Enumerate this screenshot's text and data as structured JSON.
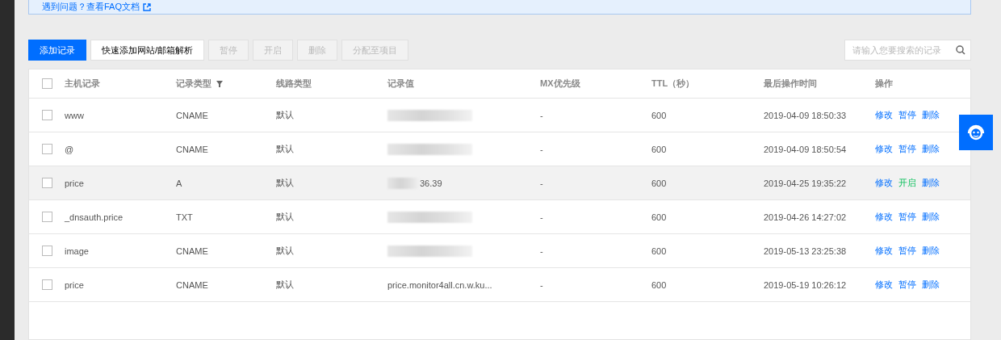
{
  "notice": {
    "text": "遇到问题？查看FAQ文档"
  },
  "toolbar": {
    "buttons": [
      {
        "label": "添加记录",
        "kind": "primary",
        "disabled": false
      },
      {
        "label": "快速添加网站/邮箱解析",
        "kind": "default",
        "disabled": false
      },
      {
        "label": "暂停",
        "kind": "default",
        "disabled": true
      },
      {
        "label": "开启",
        "kind": "default",
        "disabled": true
      },
      {
        "label": "删除",
        "kind": "default",
        "disabled": true
      },
      {
        "label": "分配至项目",
        "kind": "default",
        "disabled": true
      }
    ],
    "search": {
      "placeholder": "请输入您要搜索的记录"
    }
  },
  "table": {
    "columns": [
      {
        "label": "主机记录",
        "filter": false
      },
      {
        "label": "记录类型",
        "filter": true
      },
      {
        "label": "线路类型",
        "filter": false
      },
      {
        "label": "记录值",
        "filter": false
      },
      {
        "label": "MX优先级",
        "filter": false
      },
      {
        "label": "TTL（秒）",
        "filter": false
      },
      {
        "label": "最后操作时间",
        "filter": false
      },
      {
        "label": "操作",
        "filter": false
      }
    ],
    "header_checked": false,
    "rows": [
      {
        "checked": false,
        "highlighted": false,
        "paused": false,
        "host": "www",
        "type": "CNAME",
        "line": "默认",
        "value": {
          "redacted": true
        },
        "mx": "-",
        "ttl": "600",
        "time": "2019-04-09 18:50:33",
        "actions": [
          "修改",
          "暂停",
          "删除"
        ]
      },
      {
        "checked": false,
        "highlighted": false,
        "paused": false,
        "host": "@",
        "type": "CNAME",
        "line": "默认",
        "value": {
          "redacted": true
        },
        "mx": "-",
        "ttl": "600",
        "time": "2019-04-09 18:50:54",
        "actions": [
          "修改",
          "暂停",
          "删除"
        ]
      },
      {
        "checked": false,
        "highlighted": true,
        "paused": true,
        "host": "price",
        "type": "A",
        "line": "默认",
        "value": {
          "redacted": true,
          "text": "36.39"
        },
        "mx": "-",
        "ttl": "600",
        "time": "2019-04-25 19:35:22",
        "actions": [
          "修改",
          "开启",
          "删除"
        ]
      },
      {
        "checked": false,
        "highlighted": false,
        "paused": false,
        "host": "_dnsauth.price",
        "type": "TXT",
        "line": "默认",
        "value": {
          "redacted": true
        },
        "mx": "-",
        "ttl": "600",
        "time": "2019-04-26 14:27:02",
        "actions": [
          "修改",
          "暂停",
          "删除"
        ]
      },
      {
        "checked": false,
        "highlighted": false,
        "paused": false,
        "host": "image",
        "type": "CNAME",
        "line": "默认",
        "value": {
          "redacted": true
        },
        "mx": "-",
        "ttl": "600",
        "time": "2019-05-13 23:25:38",
        "actions": [
          "修改",
          "暂停",
          "删除"
        ]
      },
      {
        "checked": false,
        "highlighted": false,
        "paused": false,
        "host": "price",
        "type": "CNAME",
        "line": "默认",
        "value": {
          "redacted": false,
          "text": "price.monitor4all.cn.w.ku..."
        },
        "mx": "-",
        "ttl": "600",
        "time": "2019-05-19 10:26:12",
        "actions": [
          "修改",
          "暂停",
          "删除"
        ]
      }
    ]
  }
}
